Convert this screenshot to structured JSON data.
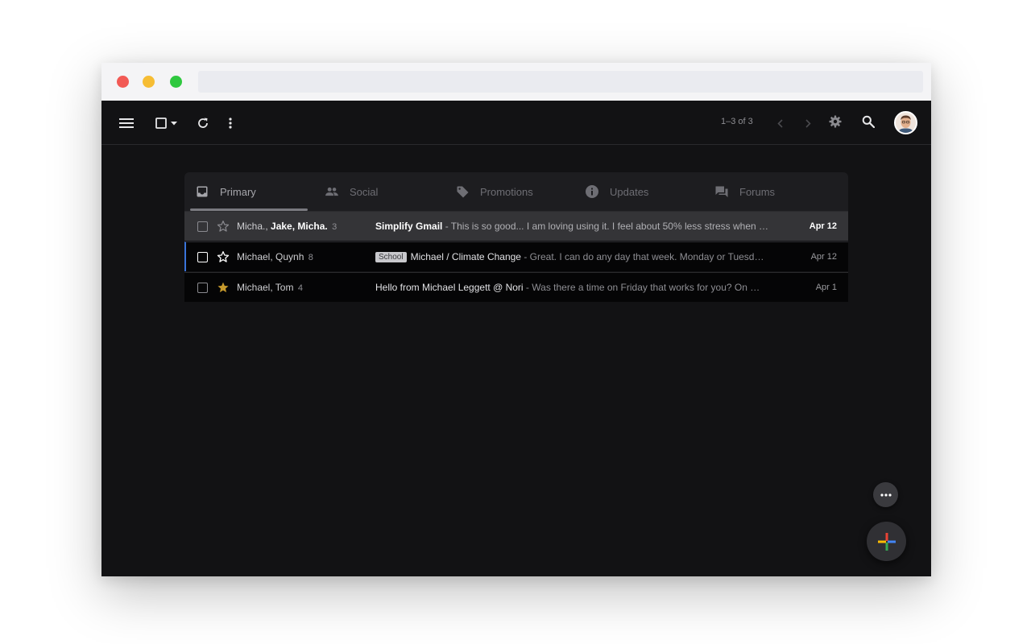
{
  "toolbar": {
    "pagination": "1–3 of 3",
    "icons": [
      "menu-icon",
      "select-all-checkbox",
      "caret-down-icon",
      "refresh-icon",
      "more-vert-icon",
      "chevron-left-icon",
      "chevron-right-icon",
      "gear-icon",
      "search-icon"
    ]
  },
  "tabs": [
    {
      "label": "Primary",
      "icon": "inbox-icon",
      "active": true
    },
    {
      "label": "Social",
      "icon": "people-icon",
      "active": false
    },
    {
      "label": "Promotions",
      "icon": "tag-icon",
      "active": false
    },
    {
      "label": "Updates",
      "icon": "info-icon",
      "active": false
    },
    {
      "label": "Forums",
      "icon": "forum-icon",
      "active": false
    }
  ],
  "emails": [
    {
      "senders_prefix": "Micha., ",
      "senders_bold": "Jake, Micha.",
      "count": "3",
      "label": "",
      "subject": "Simplify Gmail",
      "snippet": " - This is so good... I am loving using it. I feel about 50% less stress when …",
      "date": "Apr 12",
      "starred": false,
      "unread": true
    },
    {
      "senders_prefix": "Michael, Quynh",
      "senders_bold": "",
      "count": "8",
      "label": "School",
      "subject": "Michael / Climate Change",
      "snippet": " - Great. I can do any day that week. Monday or Tuesd…",
      "date": "Apr 12",
      "starred": false,
      "unread": false
    },
    {
      "senders_prefix": "Michael, Tom",
      "senders_bold": "",
      "count": "4",
      "label": "",
      "subject": "Hello from Michael Leggett @ Nori",
      "snippet": " - Was there a time on Friday that works for you? On …",
      "date": "Apr 1",
      "starred": true,
      "unread": false
    }
  ],
  "colors": {
    "background": "#121214",
    "star_active": "#c69a2c",
    "focus_accent": "#3a74d9"
  }
}
